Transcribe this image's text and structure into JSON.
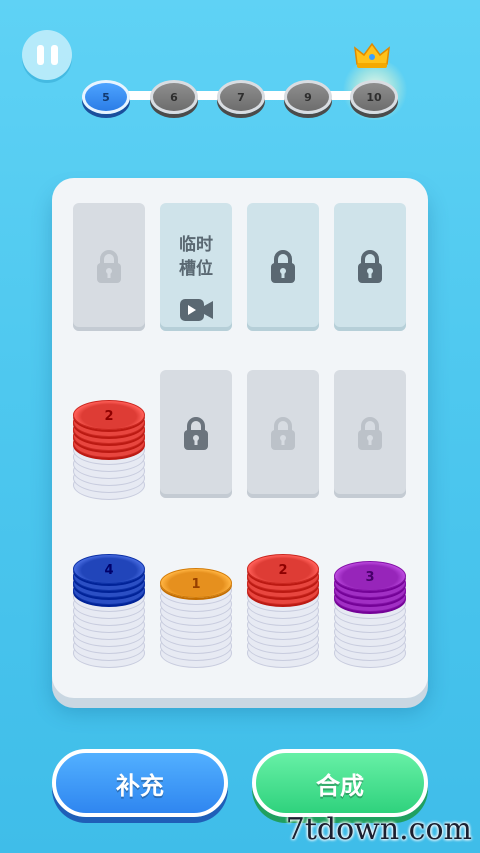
{
  "hud": {
    "levels": [
      "5",
      "6",
      "7",
      "9",
      "10"
    ],
    "current_level": "5"
  },
  "board": {
    "temp_slot_label": "临时\n槽位",
    "stacks": [
      {
        "top_number": "2",
        "color": "#e8463f"
      },
      {
        "top_number": "4",
        "color": "#2b4fc4"
      },
      {
        "top_number": "1",
        "color": "#f09a28"
      },
      {
        "top_number": "2",
        "color": "#e8463f"
      },
      {
        "top_number": "3",
        "color": "#a12fc4"
      }
    ]
  },
  "buttons": {
    "supply_label": "补充",
    "merge_label": "合成"
  },
  "watermark": "7tdown.com",
  "colors": {
    "background": "#4ec8ef",
    "board": "#f2f5f8",
    "supply_button": "#2f86f0",
    "merge_button": "#2fd27d"
  }
}
